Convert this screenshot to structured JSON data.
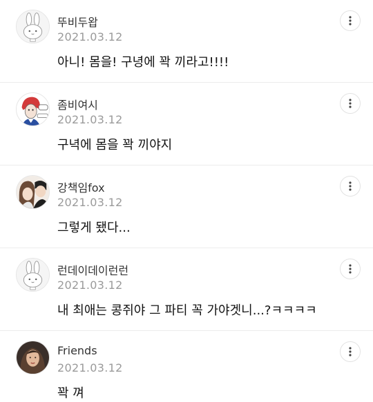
{
  "comments": [
    {
      "author": "뚜비두왑",
      "date": "2021.03.12",
      "text": "아니! 몸을! 구녕에 꽉 끼라고!!!!",
      "avatar": "bunny-avatar-icon"
    },
    {
      "author": "좀비여시",
      "date": "2021.03.12",
      "text": "구녁에 몸을 꽉 끼야지",
      "avatar": "zombie-illustration-avatar"
    },
    {
      "author": "강책임fox",
      "date": "2021.03.12",
      "text": "그렇게 됐다...",
      "avatar": "couple-illustration-avatar"
    },
    {
      "author": "런데이데이런런",
      "date": "2021.03.12",
      "text": "내 최애는 콩쥐야 그 파티 꼭 가야겟니...?ㅋㅋㅋㅋ",
      "avatar": "bunny-avatar-icon"
    },
    {
      "author": "Friends",
      "date": "2021.03.12",
      "text": "꽉 껴",
      "avatar": "photo-avatar"
    }
  ],
  "icons": {
    "more": "more-vertical-icon"
  }
}
